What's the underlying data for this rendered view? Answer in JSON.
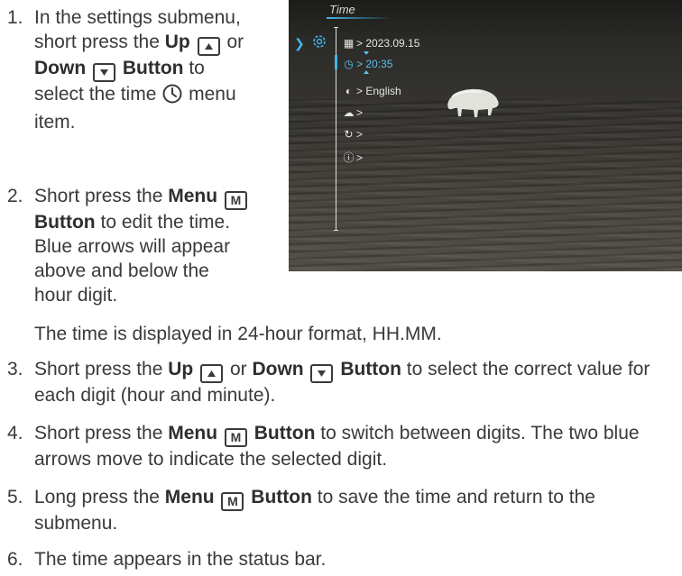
{
  "steps": [
    {
      "num": "1.",
      "p1": "In the settings submenu, short press the",
      "b1": "Up",
      "k1": "up-key",
      "or": "or",
      "b2": "Down",
      "k2": "down-key",
      "b3": "Button",
      "p2": "to select the time",
      "clock": "clock-icon",
      "p3": "menu item."
    },
    {
      "num": "2.",
      "p1": "Short press the",
      "b1": "Menu",
      "key": "M",
      "b2": "Button",
      "p2": "to edit the time. Blue arrows will appear above and below the hour digit.",
      "p3": "The time is displayed in 24-hour format, HH.MM."
    },
    {
      "num": "3.",
      "p1": "Short press the",
      "b1": "Up",
      "or": "or",
      "b2": "Down",
      "b3": "Button",
      "p2": "to select the correct value for each digit (hour and minute)."
    },
    {
      "num": "4.",
      "p1": "Short press the",
      "b1": "Menu",
      "key": "M",
      "b2": "Button",
      "p2": "to switch between digits. The two blue arrows move to indicate the selected digit."
    },
    {
      "num": "5.",
      "p1": "Long press the",
      "b1": "Menu",
      "key": "M",
      "b2": "Button",
      "p2": "to save the time and return to the submenu."
    },
    {
      "num": "6.",
      "p1": "The time appears in the status bar."
    }
  ],
  "screen": {
    "title": "Time",
    "rows": [
      {
        "icon": "calendar-icon",
        "label": "> 2023.09.15",
        "active": false
      },
      {
        "icon": "clock-icon",
        "label": "> 20:35",
        "active": true
      },
      {
        "icon": "globe-icon",
        "label": "> English",
        "active": false
      },
      {
        "icon": "cloud-upload-icon",
        "label": ">",
        "active": false
      },
      {
        "icon": "reset-icon",
        "label": ">",
        "active": false
      },
      {
        "icon": "info-icon",
        "label": ">",
        "active": false
      }
    ],
    "colors": {
      "accent": "#44b3e8",
      "menu_text": "#e6e6e6"
    }
  }
}
